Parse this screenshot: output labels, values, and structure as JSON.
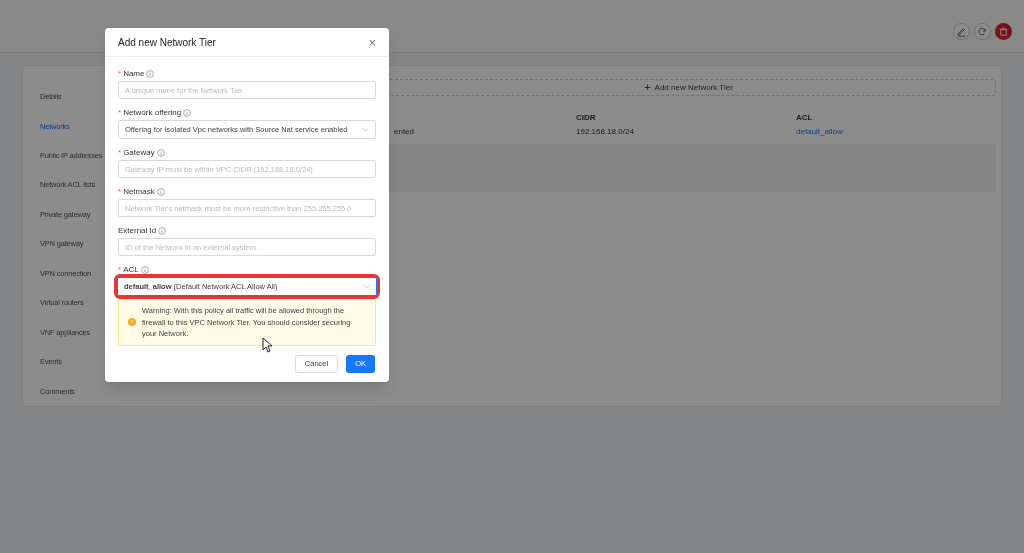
{
  "header": {
    "actions": [
      {
        "kind": "edit"
      },
      {
        "kind": "refresh"
      },
      {
        "kind": "delete"
      }
    ]
  },
  "sidebar": {
    "items": [
      {
        "label": "Details",
        "selected": false
      },
      {
        "label": "Networks",
        "selected": true
      },
      {
        "label": "Public IP addresses",
        "selected": false
      },
      {
        "label": "Network ACL lists",
        "selected": false
      },
      {
        "label": "Private gateway",
        "selected": false
      },
      {
        "label": "VPN gateway",
        "selected": false
      },
      {
        "label": "VPN connection",
        "selected": false
      },
      {
        "label": "Virtual routers",
        "selected": false
      },
      {
        "label": "VNF appliances",
        "selected": false
      },
      {
        "label": "Events",
        "selected": false
      },
      {
        "label": "Comments",
        "selected": false
      }
    ]
  },
  "add_button": {
    "icon": "+",
    "label": "Add new Network Tier"
  },
  "table": {
    "columns": [
      "CIDR",
      "ACL"
    ],
    "rows": [
      {
        "column_1": "ented",
        "cidr": "192.168.18.0/24",
        "acl": "default_allow"
      }
    ]
  },
  "modal": {
    "title": "Add new Network Tier",
    "close": "×",
    "fields": [
      {
        "kind": "input",
        "required_mark": "*",
        "label": "Name",
        "placeholder": "A unique name for the Network Tier."
      },
      {
        "kind": "select",
        "required_mark": "*",
        "label": "Network offering",
        "value": "Offering for Isolated Vpc networks with Source Nat service enabled",
        "highlighted": false
      },
      {
        "kind": "input",
        "required_mark": "*",
        "label": "Gateway",
        "placeholder": "Gateway IP must be within VPC CIDR (192.168.18.0/24)"
      },
      {
        "kind": "input",
        "required_mark": "*",
        "label": "Netmask",
        "placeholder": "Network Tier's netmask must be more restrictive than 255.255.255.0"
      },
      {
        "kind": "input",
        "label": "External Id",
        "placeholder": "ID of the Network in an external system."
      },
      {
        "kind": "select",
        "required_mark": "*",
        "label": "ACL",
        "value": "**default_allow** (Default Network ACL Allow All)",
        "highlighted": true
      }
    ],
    "warning": "Warning: With this policy all traffic will be allowed through the firewall to this VPC Network Tier. You should consider securing your Network.",
    "buttons": [
      {
        "label": "Cancel",
        "primary": false
      },
      {
        "label": "OK",
        "primary": true
      }
    ]
  }
}
